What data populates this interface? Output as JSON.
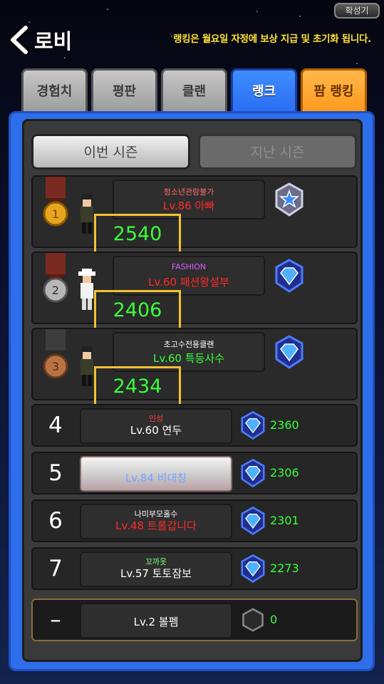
{
  "top": {
    "zoom_label": "확성기",
    "back_label": "로비",
    "notice": "랭킹은 월요일 자정에 보상 지급 및 초기화 됩니다."
  },
  "tabs": [
    {
      "label": "경험치",
      "state": "inactive"
    },
    {
      "label": "평판",
      "state": "inactive"
    },
    {
      "label": "클랜",
      "state": "inactive"
    },
    {
      "label": "랭크",
      "state": "active"
    },
    {
      "label": "팜 랭킹",
      "state": "inactive"
    }
  ],
  "season": {
    "current_label": "이번 시즌",
    "previous_label": "지난 시즌"
  },
  "rankings": [
    {
      "rank": "1",
      "clan": "청소년관람불가",
      "clan_color": "#ff6b6b",
      "level_name": "Lv.86 아빠",
      "name_color": "#ff2a2a",
      "score": "2540",
      "emblem": "master-emblem-icon"
    },
    {
      "rank": "2",
      "clan": "FASHION",
      "clan_color": "#e05cff",
      "level_name": "Lv.60 패션왕설부",
      "name_color": "#ff2a2a",
      "score": "2406",
      "emblem": "diamond-emblem-icon"
    },
    {
      "rank": "3",
      "clan": "초고수전용클랜",
      "clan_color": "#ffffff",
      "level_name": "Lv.60 특등사수",
      "name_color": "#3bff3b",
      "score": "2434",
      "emblem": "diamond-emblem-icon"
    },
    {
      "rank": "4",
      "clan": "인성",
      "clan_color": "#ff3b3b",
      "level_name": "Lv.60 연두",
      "name_color": "#ffffff",
      "score": "2360",
      "emblem": "diamond-emblem-icon"
    },
    {
      "rank": "5",
      "clan": "",
      "clan_color": "#ffffff",
      "level_name": "Lv.84 비대칭",
      "name_color": "#6fa6ff",
      "score": "2306",
      "emblem": "diamond-emblem-icon"
    },
    {
      "rank": "6",
      "clan": "나미부모홀수",
      "clan_color": "#ffffff",
      "level_name": "Lv.48 트롤갑니다",
      "name_color": "#ff2a2a",
      "score": "2301",
      "emblem": "diamond-emblem-icon"
    },
    {
      "rank": "7",
      "clan": "꼬까옷",
      "clan_color": "#7dff7d",
      "level_name": "Lv.57 토토잠보",
      "name_color": "#ffffff",
      "score": "2273",
      "emblem": "diamond-emblem-icon"
    }
  ],
  "me": {
    "rank": "–",
    "level_name": "Lv.2 볼펨",
    "score": "0",
    "emblem": "unranked-emblem-icon"
  },
  "colors": {
    "score_highlight_border": "#f1c232",
    "score_text": "#39ff3a",
    "active_tab": "#2a6df2",
    "farm_tab": "#ff9a1f",
    "panel": "#2f6eea"
  }
}
